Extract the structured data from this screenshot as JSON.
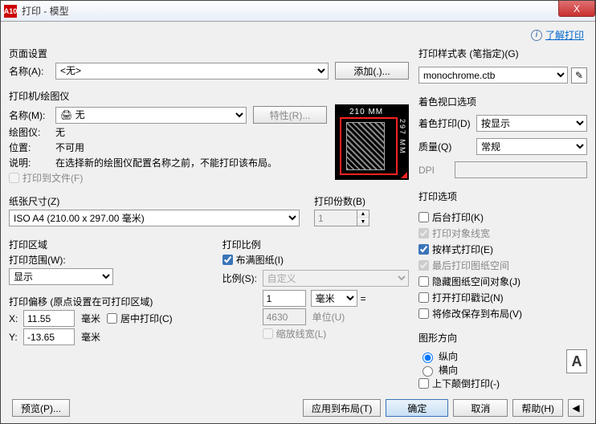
{
  "titlebar": {
    "app_icon": "A10",
    "title": "打印 - 模型",
    "close": "X"
  },
  "learn_link": "了解打印",
  "page_setup": {
    "heading": "页面设置",
    "name_label": "名称(A):",
    "name_value": "<无>",
    "add_button": "添加(.)..."
  },
  "printer": {
    "heading": "打印机/绘图仪",
    "name_label": "名称(M):",
    "name_value": "🖨 无",
    "props_button": "特性(R)...",
    "plotter_label": "绘图仪:",
    "plotter_value": "无",
    "location_label": "位置:",
    "location_value": "不可用",
    "desc_label": "说明:",
    "desc_value": "在选择新的绘图仪配置名称之前，不能打印该布局。",
    "to_file_label": "打印到文件(F)",
    "preview_w": "210 MM",
    "preview_h": "297 MM"
  },
  "paper": {
    "heading": "纸张尺寸(Z)",
    "value": "ISO A4 (210.00 x 297.00 毫米)"
  },
  "copies": {
    "heading": "打印份数(B)",
    "value": "1"
  },
  "area": {
    "heading": "打印区域",
    "what_label": "打印范围(W):",
    "what_value": "显示"
  },
  "scale": {
    "heading": "打印比例",
    "fit_label": "布满图纸(I)",
    "ratio_label": "比例(S):",
    "ratio_value": "自定义",
    "unit_count": "1",
    "unit": "毫米",
    "drawing_units": "4630",
    "du_label": "单位(U)",
    "scale_lw_label": "缩放线宽(L)"
  },
  "offset": {
    "heading": "打印偏移 (原点设置在可打印区域)",
    "x_label": "X:",
    "x_value": "11.55",
    "x_unit": "毫米",
    "y_label": "Y:",
    "y_value": "-13.65",
    "y_unit": "毫米",
    "center_label": "居中打印(C)"
  },
  "styletable": {
    "heading": "打印样式表 (笔指定)(G)",
    "value": "monochrome.ctb"
  },
  "shaded": {
    "heading": "着色视口选项",
    "shade_label": "着色打印(D)",
    "shade_value": "按显示",
    "quality_label": "质量(Q)",
    "quality_value": "常规",
    "dpi_label": "DPI",
    "dpi_value": ""
  },
  "options": {
    "heading": "打印选项",
    "bg": "后台打印(K)",
    "lw": "打印对象线宽",
    "styles": "按样式打印(E)",
    "paperspace_last": "最后打印图纸空间",
    "hide": "隐藏图纸空间对象(J)",
    "stamp": "打开打印戳记(N)",
    "save": "将修改保存到布局(V)"
  },
  "orientation": {
    "heading": "图形方向",
    "portrait": "纵向",
    "landscape": "横向",
    "upside": "上下颠倒打印(-)",
    "icon_letter": "A"
  },
  "footer": {
    "preview": "预览(P)...",
    "apply": "应用到布局(T)",
    "ok": "确定",
    "cancel": "取消",
    "help": "帮助(H)"
  }
}
